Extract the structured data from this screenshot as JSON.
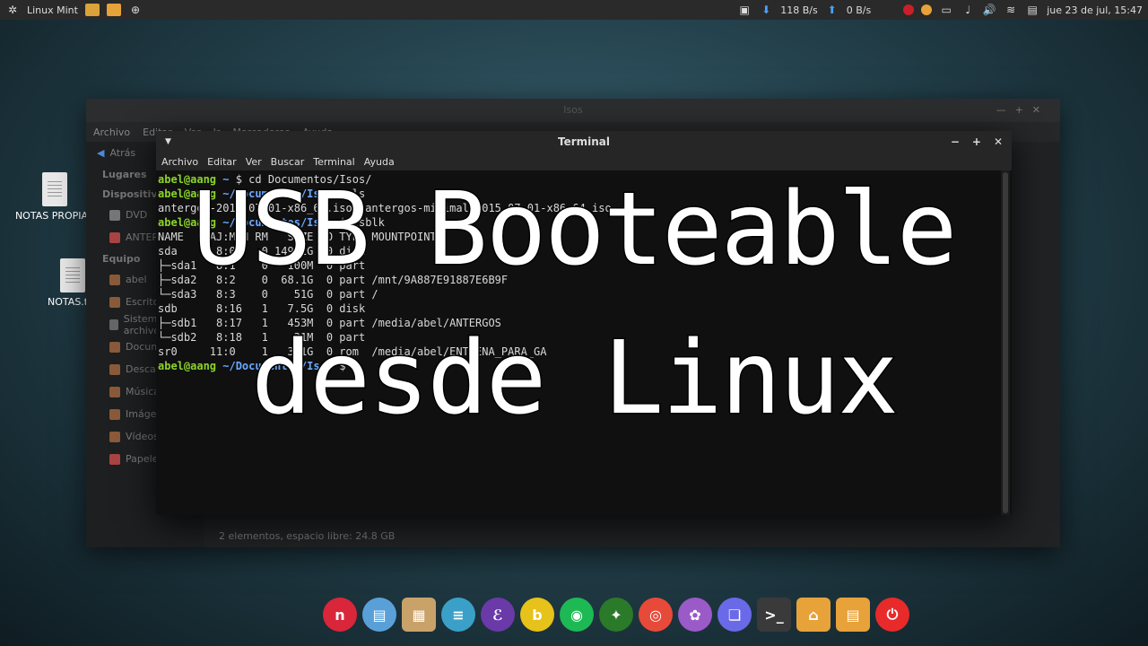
{
  "panel": {
    "menu_label": "Linux Mint",
    "net_down": "118 B/s",
    "net_up": "0 B/s",
    "clock": "jue 23 de jul, 15:47"
  },
  "desktop": {
    "icons": [
      {
        "label": "NOTAS PROPIAS"
      },
      {
        "label": "NOTAS.txt"
      }
    ]
  },
  "file_manager": {
    "title": "Isos",
    "menu": [
      "Archivo",
      "Editar",
      "Ver",
      "Ir",
      "Marcadores",
      "Ayuda"
    ],
    "back_label": "Atrás",
    "sidebar_sections": {
      "lugares": "Lugares",
      "dispositivos": "Dispositivos",
      "equipo": "Equipo"
    },
    "sidebar_items": [
      "abel",
      "Escritorio",
      "Sistema de archivos",
      "Documentos",
      "Descargas",
      "Música",
      "Imágenes",
      "Vídeos",
      "Papelera"
    ],
    "device_items": [
      "DVD",
      "ANTERGOS"
    ],
    "status": "2 elementos, espacio libre: 24.8 GB"
  },
  "terminal": {
    "title": "Terminal",
    "menu": [
      "Archivo",
      "Editar",
      "Ver",
      "Buscar",
      "Terminal",
      "Ayuda"
    ],
    "lines": [
      {
        "prompt": "abel@aang",
        "path": "~",
        "cmd": "$ cd Documentos/Isos/"
      },
      {
        "prompt": "abel@aang",
        "path": "~/Documentos/Isos",
        "cmd": "$ ls"
      },
      {
        "text": "antergos-2015.07.01-x86_64.iso  antergos-minimal-2015.07.01-x86_64.iso"
      },
      {
        "prompt": "abel@aang",
        "path": "~/Documentos/Isos",
        "cmd": "$ lsblk"
      },
      {
        "text": "NAME   MAJ:MIN RM   SIZE RO TYPE MOUNTPOINT"
      },
      {
        "text": "sda      8:0    0 149.2G  0 disk "
      },
      {
        "text": "├─sda1   8:1    0   100M  0 part "
      },
      {
        "text": "├─sda2   8:2    0  68.1G  0 part /mnt/9A887E91887E6B9F"
      },
      {
        "text": "└─sda3   8:3    0    51G  0 part /"
      },
      {
        "text": "sdb      8:16   1   7.5G  0 disk "
      },
      {
        "text": "├─sdb1   8:17   1   453M  0 part /media/abel/ANTERGOS"
      },
      {
        "text": "└─sdb2   8:18   1    31M  0 part "
      },
      {
        "text": "sr0     11:0    1   3.1G  0 rom  /media/abel/ENTRENA_PARA_GA"
      },
      {
        "prompt": "abel@aang",
        "path": "~/Documentos/Isos",
        "cmd": "$ "
      }
    ]
  },
  "overlay": {
    "line1": "USB Booteable",
    "line2": "desde Linux"
  },
  "dock": {
    "icons": [
      "menu-icon",
      "files-icon",
      "archive-icon",
      "text-editor-icon",
      "emacs-icon",
      "bleachbit-icon",
      "spotify-icon",
      "jdownloader-icon",
      "chrome-icon",
      "pidgin-icon",
      "virtualbox-icon",
      "terminal-icon",
      "home-folder-icon",
      "documents-folder-icon",
      "power-icon"
    ],
    "colors": [
      "#d9263a",
      "#5aa0d8",
      "#c9a26a",
      "#3aa0c8",
      "#6a3aa8",
      "#e6c21a",
      "#1db954",
      "#2a7a2a",
      "#e84a3a",
      "#9a5ac8",
      "#6a6ae8",
      "#3a3a3a",
      "#e8a23a",
      "#e8a23a",
      "#e82a2a"
    ]
  }
}
